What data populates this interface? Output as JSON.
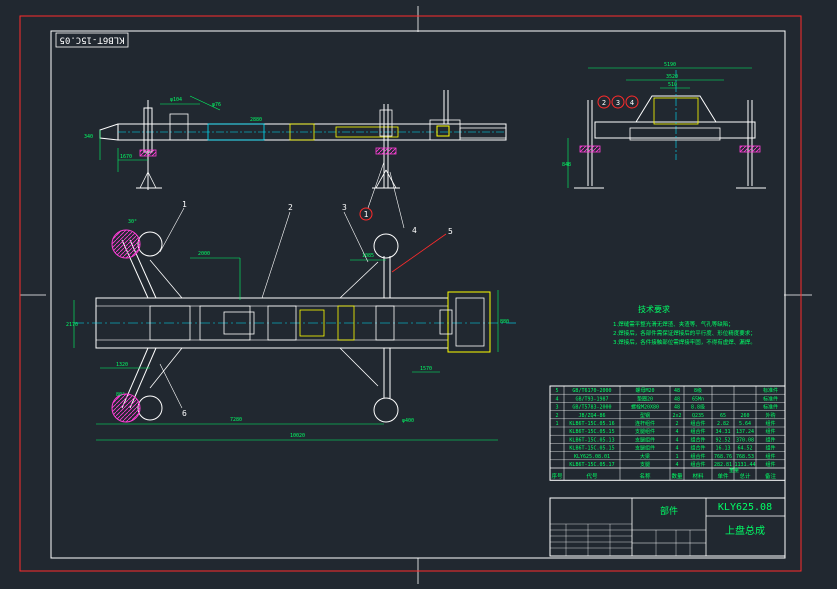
{
  "drawing": {
    "code_rotated": "KLB6T-15C.05",
    "balloons": [
      "1",
      "2",
      "3",
      "4",
      "5",
      "6"
    ],
    "side_view_balloons": [
      "2",
      "3",
      "4"
    ],
    "tech_title": "技术要求",
    "tech_lines": [
      "1.焊缝需平整光滑无焊渣、夹渣等、气孔等缺陷；",
      "2.焊接后，各部件需保证焊接后的平行度、形位精度要求；",
      "3.焊接后，各件接触部位需焊接牢固，不得有虚焊、漏焊。"
    ]
  },
  "bom": {
    "rows": [
      {
        "no": "5",
        "code": "GB/T6170-2000",
        "name": "螺母M20",
        "qty": "48",
        "mat": "8级",
        "w1": "",
        "w2": "",
        "note": "标准件"
      },
      {
        "no": "4",
        "code": "GB/T93-1987",
        "name": "垫圈20",
        "qty": "48",
        "mat": "65Mn",
        "w1": "",
        "w2": "",
        "note": "标准件"
      },
      {
        "no": "3",
        "code": "GB/T5783-2000",
        "name": "螺栓M20X80",
        "qty": "48",
        "mat": "8.8级",
        "w1": "",
        "w2": "",
        "note": "标准件"
      },
      {
        "no": "2",
        "code": "JB/ZQ4-86",
        "name": "型钢",
        "qty": "2x2",
        "mat": "Q235",
        "w1": "65",
        "w2": "260",
        "note": "外购"
      },
      {
        "no": "1",
        "code": "KLB6T-15C.05.16",
        "name": "连杆组件",
        "qty": "2",
        "mat": "组合件",
        "w1": "2.82",
        "w2": "5.64",
        "note": "组件"
      },
      {
        "no": "",
        "code": "KLB6T-15C.05.15",
        "name": "支腿组件",
        "qty": "4",
        "mat": "组合件",
        "w1": "34.31",
        "w2": "137.24",
        "note": "组件"
      },
      {
        "no": "",
        "code": "KLB6T-15C.05.13",
        "name": "支腿组件",
        "qty": "4",
        "mat": "组合件",
        "w1": "92.52",
        "w2": "370.08",
        "note": "组件"
      },
      {
        "no": "",
        "code": "KLB6T-15C.05.15",
        "name": "支腿组件",
        "qty": "4",
        "mat": "组合件",
        "w1": "16.13",
        "w2": "64.52",
        "note": "组件"
      },
      {
        "no": "",
        "code": "KLY625.08.01",
        "name": "大梁",
        "qty": "1",
        "mat": "组合件",
        "w1": "768.76",
        "w2": "768.53",
        "note": "组件"
      },
      {
        "no": "",
        "code": "KLB6T-15C.05.17",
        "name": "支腿",
        "qty": "4",
        "mat": "组合件",
        "w1": "282.81",
        "w2": "1131.44",
        "note": "组件"
      }
    ],
    "header": [
      "序号",
      "代号",
      "名称",
      "数量",
      "材料",
      "单件",
      "总计",
      "备注"
    ],
    "weight_header": "重量"
  },
  "title_block": {
    "part_label": "部件",
    "drawing_no": "KLY625.08",
    "drawing_name": "上盘总成"
  }
}
